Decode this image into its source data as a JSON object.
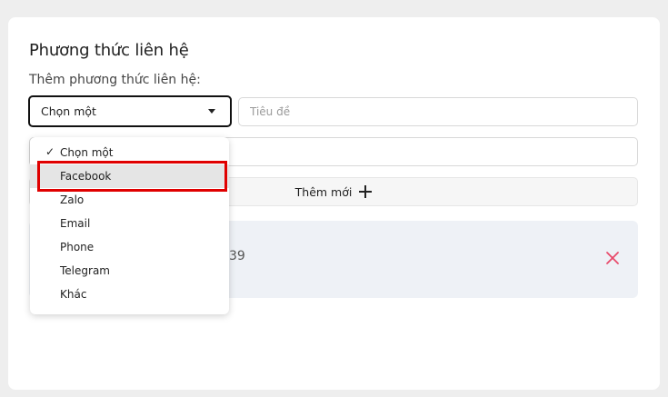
{
  "section": {
    "title": "Phương thức liên hệ",
    "add_label": "Thêm phương thức liên hệ:"
  },
  "form": {
    "select_value": "Chọn một",
    "title_placeholder": "Tiêu đề",
    "value_placeholder": "",
    "add_button_label": "Thêm mới"
  },
  "contact_item": {
    "value_fragment": "39"
  },
  "dropdown": {
    "check_mark": "✓",
    "options": [
      "Chọn một",
      "Facebook",
      "Zalo",
      "Email",
      "Phone",
      "Telegram",
      "Khác"
    ],
    "selected_index": 0,
    "hover_index": 1
  },
  "colors": {
    "highlight_box": "#e00000",
    "remove_icon": "#e84a6a"
  }
}
